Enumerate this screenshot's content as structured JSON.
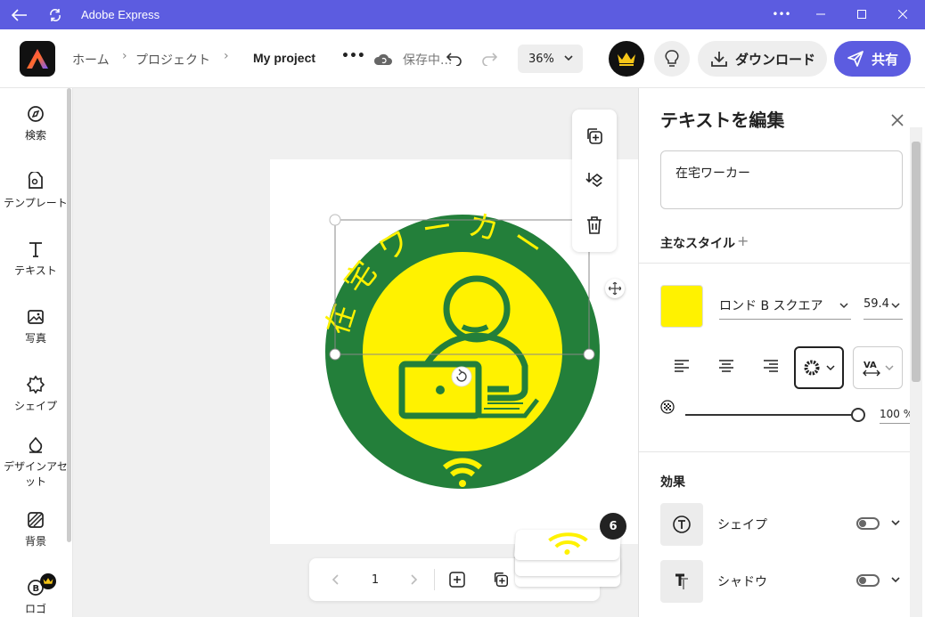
{
  "window": {
    "title": "Adobe Express",
    "more_label": "•••"
  },
  "header": {
    "breadcrumb": [
      "ホーム",
      "プロジェクト"
    ],
    "project_name": "My project",
    "more_label": "•••",
    "save_status": "保存中...",
    "zoom": "36%",
    "download_label": "ダウンロード",
    "share_label": "共有"
  },
  "rail": {
    "items": [
      {
        "label": "検索",
        "icon": "search-icon"
      },
      {
        "label": "テンプレート",
        "icon": "template-icon"
      },
      {
        "label": "テキスト",
        "icon": "text-icon"
      },
      {
        "label": "写真",
        "icon": "photo-icon"
      },
      {
        "label": "シェイプ",
        "icon": "shape-icon"
      },
      {
        "label": "デザインアセット",
        "icon": "design-asset-icon"
      },
      {
        "label": "背景",
        "icon": "background-icon"
      },
      {
        "label": "ロゴ",
        "icon": "logo-icon"
      }
    ]
  },
  "canvas": {
    "curved_text": "在宅ワーカー",
    "page_number": "1",
    "page_count_badge": "6",
    "colors": {
      "green": "#237f3a",
      "yellow": "#fff200"
    }
  },
  "panel": {
    "title": "テキストを編集",
    "text_value": "在宅ワーカー",
    "main_style_label": "主なスタイル",
    "font_name": "ロンド B スクエア",
    "font_size": "59.4",
    "opacity": "100 %",
    "effects_label": "効果",
    "effects": [
      {
        "label": "シェイプ",
        "icon": "shape-text-icon"
      },
      {
        "label": "シャドウ",
        "icon": "shadow-text-icon"
      }
    ],
    "text_color": "#fff200"
  }
}
